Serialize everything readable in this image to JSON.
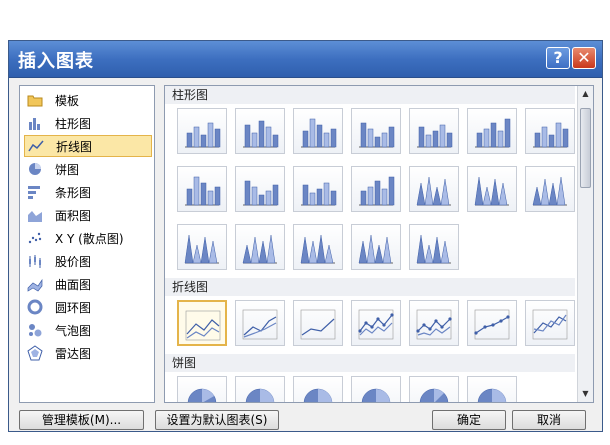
{
  "dialog": {
    "title": "插入图表",
    "help_label": "?",
    "close_label": "✕"
  },
  "categories": [
    {
      "label": "模板",
      "icon": "folder-icon"
    },
    {
      "label": "柱形图",
      "icon": "column-chart-icon"
    },
    {
      "label": "折线图",
      "icon": "line-chart-icon"
    },
    {
      "label": "饼图",
      "icon": "pie-chart-icon"
    },
    {
      "label": "条形图",
      "icon": "bar-chart-icon"
    },
    {
      "label": "面积图",
      "icon": "area-chart-icon"
    },
    {
      "label": "X Y (散点图)",
      "icon": "scatter-chart-icon"
    },
    {
      "label": "股价图",
      "icon": "stock-chart-icon"
    },
    {
      "label": "曲面图",
      "icon": "surface-chart-icon"
    },
    {
      "label": "圆环图",
      "icon": "doughnut-chart-icon"
    },
    {
      "label": "气泡图",
      "icon": "bubble-chart-icon"
    },
    {
      "label": "雷达图",
      "icon": "radar-chart-icon"
    }
  ],
  "selected_category": "折线图",
  "sections": {
    "column": "柱形图",
    "line": "折线图",
    "pie": "饼图"
  },
  "buttons": {
    "manage_templates": "管理模板(M)...",
    "set_default": "设置为默认图表(S)",
    "ok": "确定",
    "cancel": "取消"
  },
  "colors": {
    "title_bar": "#3d6fc0",
    "selection": "#fbe7a6",
    "chart_blue": "#6b86c4"
  }
}
